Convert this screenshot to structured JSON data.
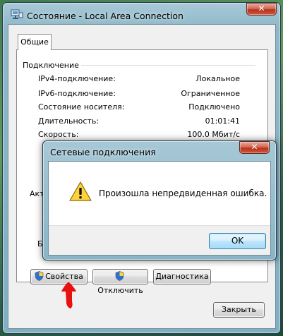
{
  "window": {
    "title": "Состояние - Local Area Connection",
    "close_glyph": "✕",
    "tab_label": "Общие"
  },
  "connection": {
    "group_label": "Подключение",
    "rows": [
      {
        "label": "IPv4-подключение:",
        "value": "Локальное"
      },
      {
        "label": "IPv6-подключение:",
        "value": "Ограниченное"
      },
      {
        "label": "Состояние носителя:",
        "value": "Подключено"
      },
      {
        "label": "Длительность:",
        "value": "01:01:41"
      },
      {
        "label": "Скорость:",
        "value": "100.0 Мбит/с"
      }
    ]
  },
  "fragments": {
    "activity": "Акти",
    "bytes": "Ба"
  },
  "buttons": {
    "properties": "Свойства",
    "disable": "Отключить",
    "diagnostics": "Диагностика",
    "close": "Закрыть"
  },
  "dialog": {
    "title": "Сетевые подключения",
    "close_glyph": "✕",
    "message": "Произошла непредвиденная ошибка.",
    "ok_label": "OK"
  },
  "colors": {
    "annotation_arrow": "#e81010",
    "close_red": "#c2412a"
  },
  "icons": {
    "window": "network-icon",
    "dialog_warning": "warning-icon",
    "button_shield": "shield-icon",
    "annotation": "arrow-up-icon"
  }
}
